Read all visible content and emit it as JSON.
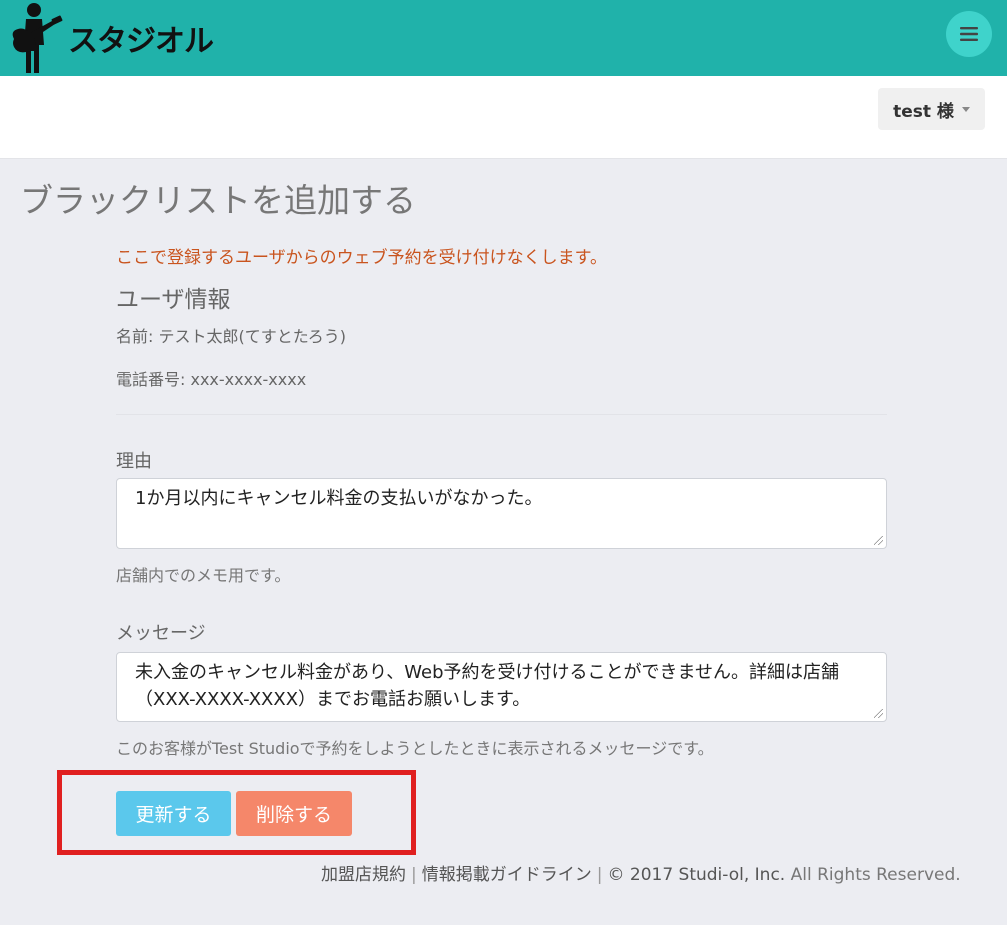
{
  "header": {
    "brand": "スタジオル",
    "menu_icon": "hamburger-icon",
    "accent": "#20b2aa"
  },
  "user_menu": {
    "label": "test 様"
  },
  "page": {
    "title": "ブラックリストを追加する",
    "notice": "ここで登録するユーザからのウェブ予約を受け付けなくします。",
    "user_info_heading": "ユーザ情報",
    "name_line": "名前: テスト太郎(てすとたろう)",
    "phone_line": "電話番号: xxx-xxxx-xxxx"
  },
  "form": {
    "reason_label": "理由",
    "reason_value": "1か月以内にキャンセル料金の支払いがなかった。",
    "reason_help": "店舗内でのメモ用です。",
    "message_label": "メッセージ",
    "message_value": "未入金のキャンセル料金があり、Web予約を受け付けることができません。詳細は店舗（XXX-XXXX-XXXX）までお電話お願いします。",
    "message_help": "このお客様がTest Studioで予約をしようとしたときに表示されるメッセージです。"
  },
  "actions": {
    "update_label": "更新する",
    "delete_label": "削除する"
  },
  "footer": {
    "terms_link": "加盟店規約",
    "guideline_link": "情報掲載ガイドライン",
    "copyright": "© 2017 Studi-ol, Inc.",
    "rights": "All Rights Reserved."
  }
}
